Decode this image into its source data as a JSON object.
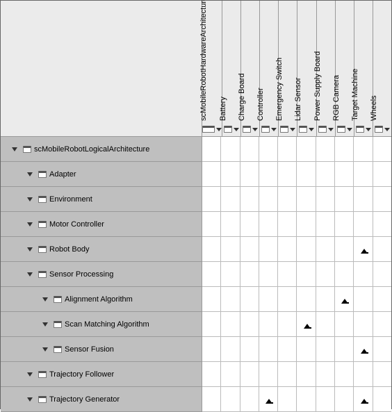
{
  "columns": [
    {
      "label": "scMobileRobotHardwareArchitecture",
      "expandable": true,
      "wide": true
    },
    {
      "label": "Battery",
      "expandable": true
    },
    {
      "label": "Charge Board",
      "expandable": true
    },
    {
      "label": "Controller",
      "expandable": true
    },
    {
      "label": "Emergency Switch",
      "expandable": true
    },
    {
      "label": "Lidar Sensor",
      "expandable": true
    },
    {
      "label": "Power Supply Board",
      "expandable": true
    },
    {
      "label": "RGB Camera",
      "expandable": true
    },
    {
      "label": "Target Machine",
      "expandable": true
    },
    {
      "label": "Wheels",
      "expandable": true
    }
  ],
  "rows": [
    {
      "label": "scMobileRobotLogicalArchitecture",
      "indent": 0,
      "expandable": true,
      "allocations": []
    },
    {
      "label": "Adapter",
      "indent": 1,
      "expandable": true,
      "allocations": []
    },
    {
      "label": "Environment",
      "indent": 1,
      "expandable": true,
      "allocations": []
    },
    {
      "label": "Motor Controller",
      "indent": 1,
      "expandable": true,
      "allocations": []
    },
    {
      "label": "Robot Body",
      "indent": 1,
      "expandable": true,
      "allocations": [
        8
      ]
    },
    {
      "label": "Sensor Processing",
      "indent": 1,
      "expandable": true,
      "allocations": []
    },
    {
      "label": "Alignment Algorithm",
      "indent": 2,
      "expandable": true,
      "allocations": [
        7
      ]
    },
    {
      "label": "Scan Matching Algorithm",
      "indent": 2,
      "expandable": true,
      "allocations": [
        5
      ]
    },
    {
      "label": "Sensor Fusion",
      "indent": 2,
      "expandable": true,
      "allocations": [
        8
      ]
    },
    {
      "label": "Trajectory Follower",
      "indent": 1,
      "expandable": true,
      "allocations": []
    },
    {
      "label": "Trajectory Generator",
      "indent": 1,
      "expandable": true,
      "allocations": [
        3,
        8
      ]
    }
  ]
}
